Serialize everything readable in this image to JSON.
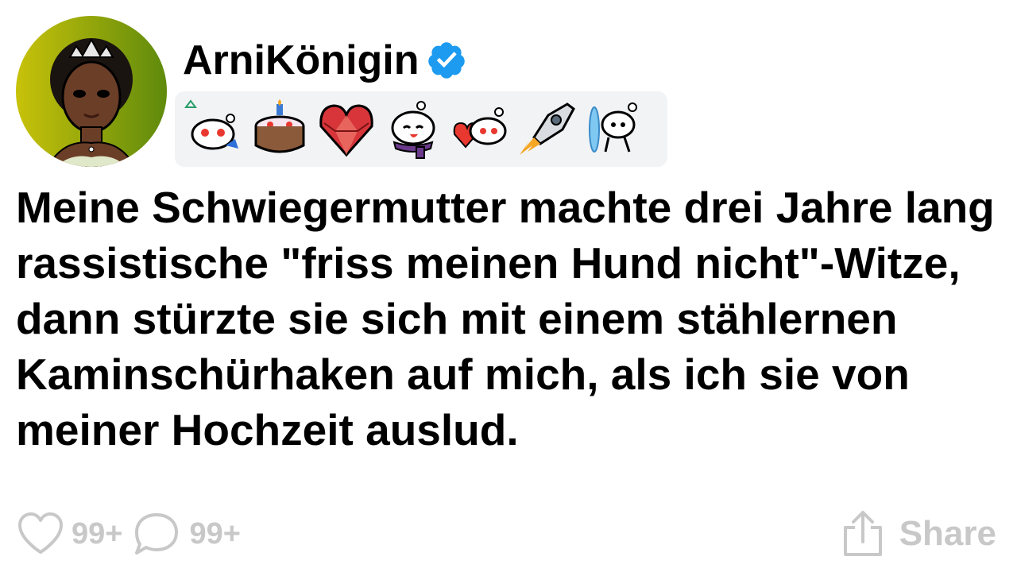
{
  "post": {
    "username": "ArniKönigin",
    "verified": true,
    "title": "Meine Schwiegermutter machte drei Jahre lang rassistische \"friss meinen Hund nicht\"-Witze, dann stürzte sie sich mit einem stählernen Kaminschürhaken auf mich, als ich sie von meiner Hochzeit auslud."
  },
  "badges": [
    "snoo-triangle-badge-icon",
    "birthday-cake-badge-icon",
    "gem-heart-badge-icon",
    "snoo-scarf-badge-icon",
    "snoo-heart-badge-icon",
    "rocket-badge-icon",
    "snoo-portal-badge-icon"
  ],
  "actions": {
    "likes": "99+",
    "comments": "99+",
    "share_label": "Share"
  },
  "colors": {
    "verified": "#1d9bf0",
    "action_gray": "#c8c8c8",
    "badge_strip_bg": "#f2f3f5"
  }
}
